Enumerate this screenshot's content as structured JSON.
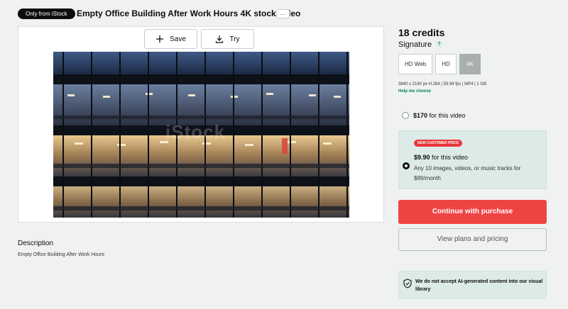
{
  "header": {
    "badge": "Only from iStock",
    "title": "Empty Office Building After Work Hours 4K stock video",
    "more_label": "..."
  },
  "preview": {
    "save_label": "Save",
    "try_label": "Try",
    "save_icon": "plus-icon",
    "try_icon": "download-icon",
    "watermark": "iStock"
  },
  "description": {
    "heading": "Description",
    "text": "Empty Office Building After Work Hours"
  },
  "pricing": {
    "credits": "18 credits",
    "plan": "Signature",
    "help_icon": "?",
    "resolutions": [
      {
        "label": "HD Web",
        "selected": false
      },
      {
        "label": "HD",
        "selected": false
      },
      {
        "label": "4K",
        "selected": true
      }
    ],
    "specs": "3840 x 2160 px H.264 | 59.94 fps | MP4 | 1 GB",
    "help_link": "Help me choose",
    "option1": {
      "price": "$170",
      "suffix": " for this video",
      "selected": false
    },
    "option2": {
      "badge": "NEW CUSTOMER PRICE",
      "price": "$9.90",
      "suffix": " for this video",
      "subtext": "Any 10 images, videos, or music tracks for $99/month",
      "selected": true
    },
    "continue_label": "Continue with purchase",
    "plans_label": "View plans and pricing",
    "ai_notice": "We do not accept AI-generated content into our visual library"
  },
  "colors": {
    "accent_red": "#ef4444",
    "link_green": "#028455",
    "panel_tint": "#dcebe8",
    "page_bg": "#f0f2f2"
  }
}
